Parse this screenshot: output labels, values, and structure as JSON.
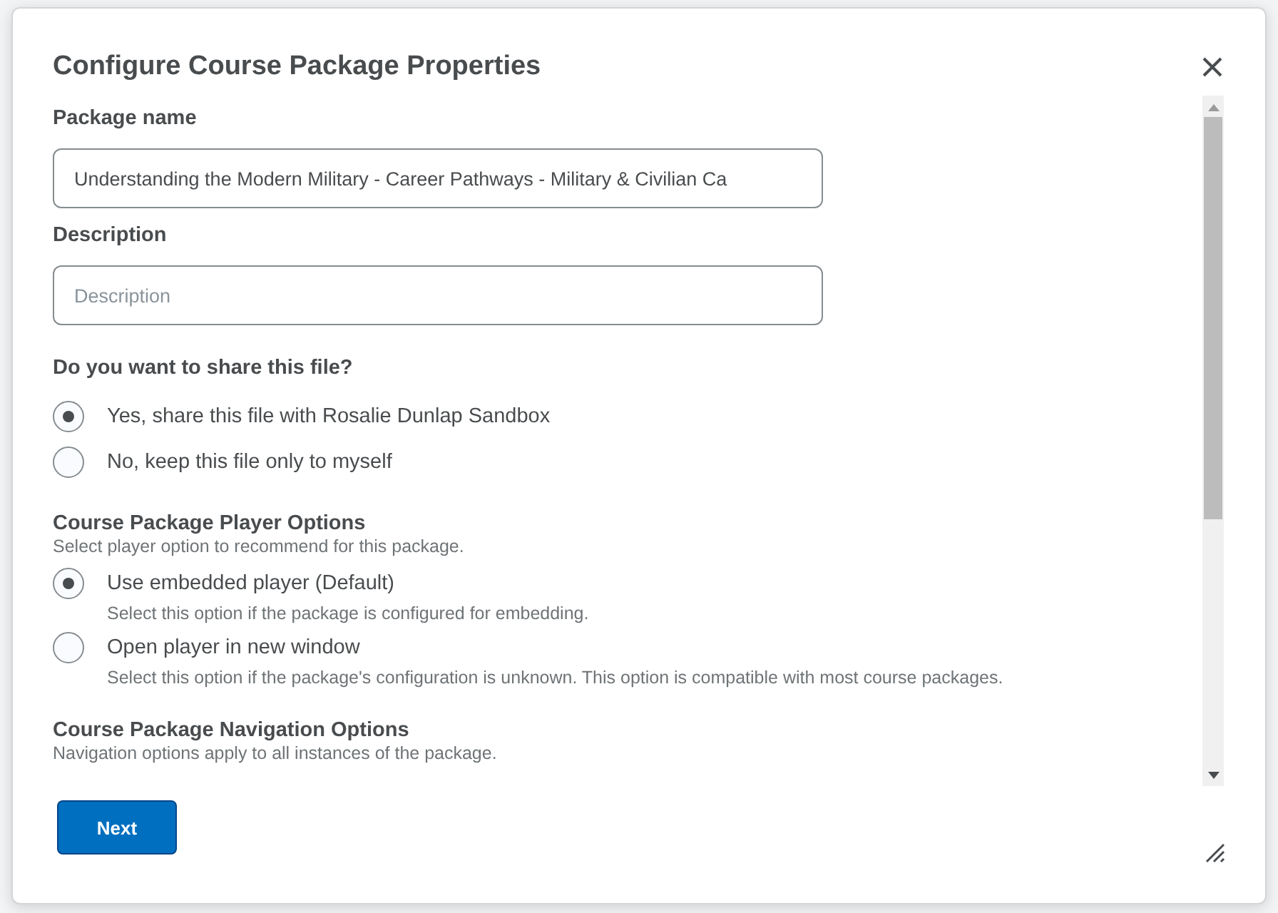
{
  "dialog": {
    "title": "Configure Course Package Properties"
  },
  "package_name": {
    "label": "Package name",
    "value": "Understanding the Modern Military - Career Pathways - Military & Civilian Ca"
  },
  "description": {
    "label": "Description",
    "placeholder": "Description"
  },
  "share": {
    "question": "Do you want to share this file?",
    "options": [
      {
        "label": "Yes, share this file with Rosalie Dunlap Sandbox",
        "selected": true
      },
      {
        "label": "No, keep this file only to myself",
        "selected": false
      }
    ]
  },
  "player_options": {
    "heading": "Course Package Player Options",
    "hint": "Select player option to recommend for this package.",
    "options": [
      {
        "label": "Use embedded player (Default)",
        "help": "Select this option if the package is configured for embedding.",
        "selected": true
      },
      {
        "label": "Open player in new window",
        "help": "Select this option if the package's configuration is unknown. This option is compatible with most course packages.",
        "selected": false
      }
    ]
  },
  "navigation_options": {
    "heading": "Course Package Navigation Options",
    "hint": "Navigation options apply to all instances of the package."
  },
  "buttons": [
    "Next"
  ]
}
